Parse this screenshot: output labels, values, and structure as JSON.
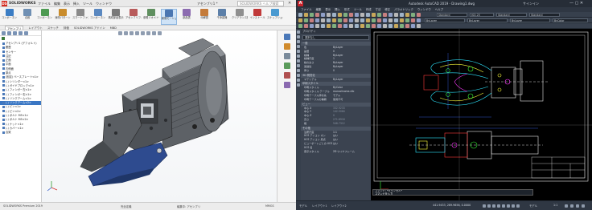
{
  "solidworks": {
    "brand": "SOLIDWORKS",
    "menu": [
      "ファイル",
      "編集",
      "表示",
      "挿入",
      "ツール",
      "ウィンドウ"
    ],
    "document_title": "アセンブリ1 *",
    "search_placeholder": "SOLIDWORKS ヘルプ検索",
    "ribbon": [
      {
        "label": "コンポーネント挿入",
        "color": "#3b7dc4"
      },
      {
        "label": "合致",
        "color": "#6f8fb3"
      },
      {
        "label": "コンポーネントプレビュー",
        "color": "#4d9a52"
      },
      {
        "label": "線形パターン",
        "color": "#c98c2c"
      },
      {
        "label": "スマートファスナー",
        "color": "#8a8a8a"
      },
      {
        "label": "コンポーネント移動",
        "color": "#5a88c0"
      },
      {
        "label": "構成部品表示",
        "color": "#7a7a7a"
      },
      {
        "label": "アセンブリフィーチャー",
        "color": "#b85b5b"
      },
      {
        "label": "参照ジオメトリ",
        "color": "#5f8f5f"
      },
      {
        "label": "新規モーション",
        "color": "#4b76b1"
      },
      {
        "label": "部品表",
        "color": "#8c6cb0"
      },
      {
        "label": "分解図",
        "color": "#c47b3a"
      },
      {
        "label": "干渉認識",
        "color": "#5c7fa8"
      },
      {
        "label": "クリアランス検証",
        "color": "#8f8f8f"
      },
      {
        "label": "インストール",
        "color": "#c03a3a"
      },
      {
        "label": "スナップショット",
        "color": "#4a9ad1"
      }
    ],
    "tabs": [
      "アセンブリ",
      "レイアウト",
      "スケッチ",
      "評価",
      "SOLIDWORKS アドイン",
      "MBD"
    ],
    "active_tab": "アセンブリ",
    "tree": [
      {
        "label": "アセンブリ1 (デフォルト)",
        "hl": false
      },
      {
        "label": "履歴",
        "hl": false
      },
      {
        "label": "センサー",
        "hl": false
      },
      {
        "label": "注記",
        "hl": false
      },
      {
        "label": "正面",
        "hl": false
      },
      {
        "label": "平面",
        "hl": false
      },
      {
        "label": "右側面",
        "hl": false
      },
      {
        "label": "原点",
        "hl": false
      },
      {
        "label": "(固定) ベースプレート<1>",
        "hl": false
      },
      {
        "label": "(-) シリンダー<1>",
        "hl": false
      },
      {
        "label": "(-) ガイドブロック<1>",
        "hl": false
      },
      {
        "label": "(-) フィンガー左<1>",
        "hl": false
      },
      {
        "label": "(-) フィンガー右<1>",
        "hl": false
      },
      {
        "label": "(-) リンクアーム<1>",
        "hl": false
      },
      {
        "label": "(-) リンクアーム<2>",
        "hl": true
      },
      {
        "label": "(-) ピン<1>",
        "hl": false
      },
      {
        "label": "(-) ピン<2>",
        "hl": false
      },
      {
        "label": "(-) ボルト M5<1>",
        "hl": false
      },
      {
        "label": "(-) ボルト M5<2>",
        "hl": false
      },
      {
        "label": "(-) ナット<1>",
        "hl": false
      },
      {
        "label": "(-) カバー<1>",
        "hl": false
      },
      {
        "label": "合致",
        "hl": false
      }
    ],
    "status": [
      "SOLIDWORKS Premium 2019",
      "完全定義",
      "編集中: アセンブリ",
      "MMGS"
    ]
  },
  "autocad": {
    "file_name": "Autodesk AutoCAD 2019 - Drawing1.dwg",
    "user": "サインイン",
    "menu": [
      "ファイル",
      "編集",
      "表示",
      "挿入",
      "形式",
      "ツール",
      "作成",
      "寸法",
      "修正",
      "パラメトリック",
      "ウィンドウ",
      "ヘルプ"
    ],
    "dropdowns": [
      "Standard",
      "ISO-25",
      "Standard",
      "Standard",
      "ByLayer",
      "ByLayer",
      "ByLayer",
      "ByColor"
    ],
    "props": {
      "header": "プロパティ",
      "selection": "選択なし",
      "sections": [
        {
          "title": "一般",
          "rows": [
            [
              "色",
              "ByLayer"
            ],
            [
              "画層",
              "0"
            ],
            [
              "線種",
              "ByLayer"
            ],
            [
              "線種尺度",
              "1"
            ],
            [
              "線の太さ",
              "ByLayer"
            ],
            [
              "透過性",
              "ByLayer"
            ],
            [
              "厚さ",
              "0"
            ]
          ]
        },
        {
          "title": "3D 視覚化",
          "rows": [
            [
              "マテリアル",
              "ByLayer"
            ]
          ]
        },
        {
          "title": "印刷スタイル",
          "rows": [
            [
              "印刷スタイル",
              "ByColor"
            ],
            [
              "印刷スタイル テーブル",
              "monochrome.ctb"
            ],
            [
              "印刷テーブル添付先",
              "モデル"
            ],
            [
              "印刷テーブルの種類",
              "使用不可"
            ]
          ]
        },
        {
          "title": "ビュー",
          "rows": [
            [
              "中心 X",
              "332.9233"
            ],
            [
              "中心 Y",
              "142.5064"
            ],
            [
              "中心 Z",
              "0"
            ],
            [
              "高さ",
              "271.8916"
            ],
            [
              "幅",
              "548.7312"
            ]
          ]
        },
        {
          "title": "その他",
          "rows": [
            [
              "注釈尺度",
              "1:1"
            ],
            [
              "UCS アイコン オン",
              "はい"
            ],
            [
              "UCS アイコン 原点",
              "はい"
            ],
            [
              "ビューポートごとの UCS",
              "はい"
            ],
            [
              "UCS 名",
              ""
            ],
            [
              "表示スタイル",
              "2D ワイヤフレーム"
            ]
          ]
        }
      ]
    },
    "command_history": "コマンド: *キャンセル*",
    "command_prompt": "コマンドを入力",
    "status": [
      "モデル",
      "レイアウト1",
      "レイアウト2",
      "441.9433, 289.9656, 0.0000",
      "モデル",
      "1:1"
    ]
  }
}
